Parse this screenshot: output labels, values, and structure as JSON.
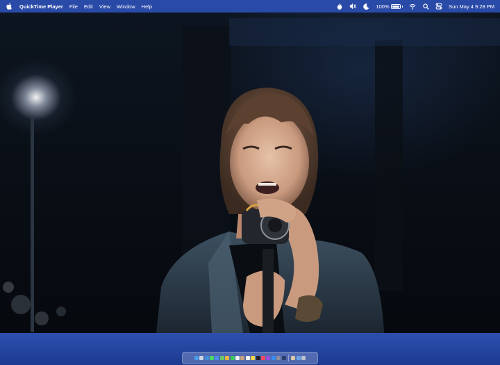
{
  "menubar": {
    "app_name": "QuickTime Player",
    "menus": [
      "File",
      "Edit",
      "View",
      "Window",
      "Help"
    ],
    "status": {
      "battery_percent": "100%",
      "battery_level": 1.0,
      "clock": "Sun May 4  9:28 PM"
    },
    "icons": [
      "apple-logo-icon",
      "flame-icon",
      "mute-icon",
      "moon-icon",
      "battery-icon",
      "wifi-icon",
      "search-icon",
      "control-center-icon"
    ]
  },
  "window": {
    "app": "QuickTime Player",
    "content": "video-frame"
  },
  "dock": {
    "icons": [
      {
        "name": "finder-icon",
        "color": "#4a9de8"
      },
      {
        "name": "launchpad-icon",
        "color": "#c9d3e6"
      },
      {
        "name": "safari-icon",
        "color": "#3f8fe0"
      },
      {
        "name": "messages-icon",
        "color": "#4cd964"
      },
      {
        "name": "mail-icon",
        "color": "#4d8ff0"
      },
      {
        "name": "maps-icon",
        "color": "#6ac96a"
      },
      {
        "name": "photos-icon",
        "color": "#f5b642"
      },
      {
        "name": "facetime-icon",
        "color": "#3cc85a"
      },
      {
        "name": "calendar-icon",
        "color": "#f2f2f2"
      },
      {
        "name": "contacts-icon",
        "color": "#c8a27a"
      },
      {
        "name": "reminders-icon",
        "color": "#f4f4f4"
      },
      {
        "name": "notes-icon",
        "color": "#f7d54a"
      },
      {
        "name": "tv-icon",
        "color": "#222222"
      },
      {
        "name": "music-icon",
        "color": "#f24b5f"
      },
      {
        "name": "podcasts-icon",
        "color": "#9a4ee0"
      },
      {
        "name": "app-store-icon",
        "color": "#3a8cf0"
      },
      {
        "name": "system-settings-icon",
        "color": "#8a8f99"
      },
      {
        "name": "quicktime-icon",
        "color": "#2c3e6b"
      },
      {
        "name": "preview-icon",
        "color": "#d8c7a8"
      },
      {
        "name": "downloads-icon",
        "color": "#6aa3e8"
      },
      {
        "name": "trash-icon",
        "color": "#b9c2cf"
      }
    ]
  }
}
